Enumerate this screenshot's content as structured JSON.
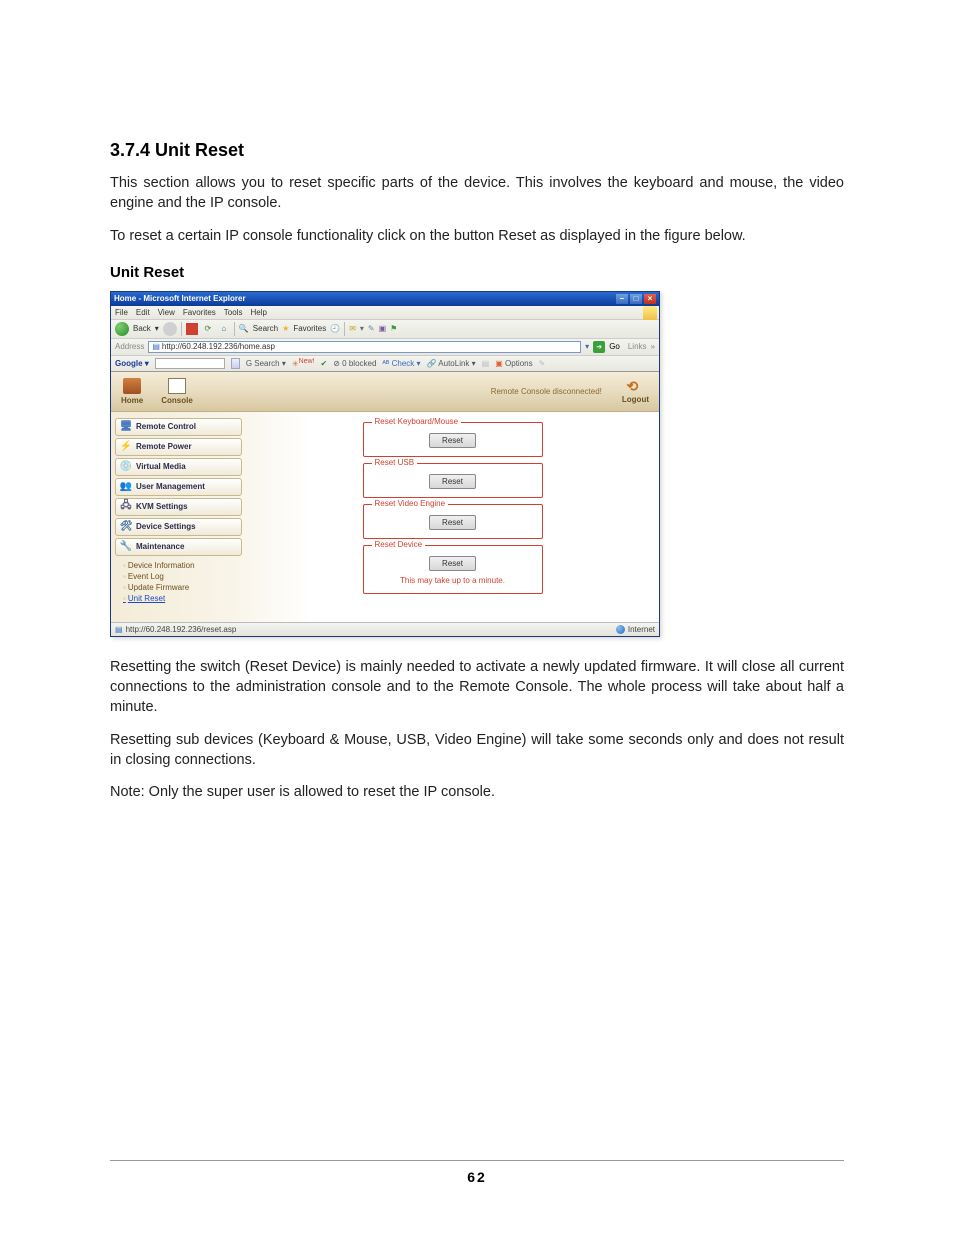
{
  "heading": "3.7.4 Unit Reset",
  "para1": "This section allows you to reset specific parts of the device. This involves the keyboard and mouse, the video engine and the IP console.",
  "para2": "To reset a certain IP console functionality click on the button Reset as displayed in the figure below.",
  "subheading": "Unit Reset",
  "para3": "Resetting the switch (Reset Device) is mainly needed to activate a newly updated firmware. It will close all current connections to the administration console and to the Remote Console. The whole process will take about half a minute.",
  "para4": "Resetting sub devices (Keyboard & Mouse, USB, Video Engine) will take some seconds only and does not result in closing connections.",
  "para5": "Note: Only the super user is allowed to reset the IP console.",
  "page_number": "62",
  "ie": {
    "title": "Home - Microsoft Internet Explorer",
    "menu": {
      "file": "File",
      "edit": "Edit",
      "view": "View",
      "favorites": "Favorites",
      "tools": "Tools",
      "help": "Help"
    },
    "toolbar": {
      "back": "Back",
      "search": "Search",
      "favorites": "Favorites"
    },
    "address_label": "Address",
    "address_value": "http://60.248.192.236/home.asp",
    "go": "Go",
    "links": "Links",
    "google": {
      "label": "Google",
      "search": "Search",
      "new": "New!",
      "blocked": "0 blocked",
      "check": "Check",
      "autolink": "AutoLink",
      "options": "Options"
    },
    "statusbar_url": "http://60.248.192.236/reset.asp",
    "statusbar_zone": "Internet"
  },
  "app": {
    "nav_home": "Home",
    "nav_console": "Console",
    "status": "Remote Console disconnected!",
    "logout": "Logout",
    "sidebar": {
      "items": [
        {
          "label": "Remote Control"
        },
        {
          "label": "Remote Power"
        },
        {
          "label": "Virtual Media"
        },
        {
          "label": "User Management"
        },
        {
          "label": "KVM Settings"
        },
        {
          "label": "Device Settings"
        },
        {
          "label": "Maintenance"
        }
      ],
      "sub": {
        "device_info": "Device Information",
        "event_log": "Event Log",
        "update_fw": "Update Firmware",
        "unit_reset": "Unit Reset"
      }
    },
    "panels": {
      "kb_mouse": {
        "legend": "Reset Keyboard/Mouse",
        "button": "Reset"
      },
      "usb": {
        "legend": "Reset USB",
        "button": "Reset"
      },
      "video": {
        "legend": "Reset Video Engine",
        "button": "Reset"
      },
      "device": {
        "legend": "Reset Device",
        "button": "Reset",
        "note": "This may take up to a minute."
      }
    }
  }
}
